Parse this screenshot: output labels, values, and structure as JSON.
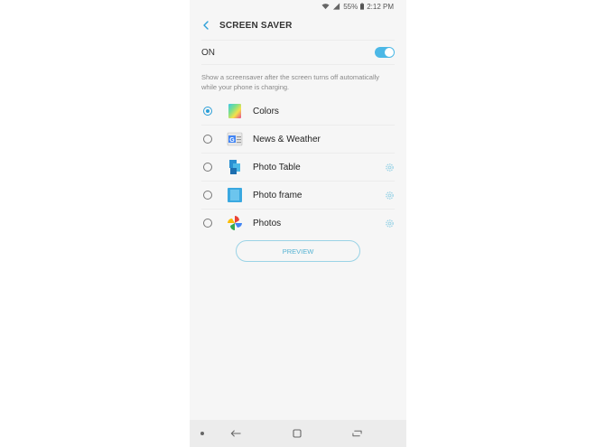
{
  "status_bar": {
    "battery": "55%",
    "time": "2:12 PM",
    "icons": [
      "wifi-icon",
      "signal-icon",
      "battery-icon"
    ]
  },
  "header": {
    "back_icon": "chevron-left-icon",
    "title": "SCREEN SAVER"
  },
  "toggle": {
    "label": "ON",
    "state": "on",
    "accent": "#4cb8e6"
  },
  "description": "Show a screensaver after the screen turns off automatically while your phone is charging.",
  "options": [
    {
      "label": "Colors",
      "icon": "colors-icon",
      "selected": true,
      "has_settings": false
    },
    {
      "label": "News & Weather",
      "icon": "news-weather-icon",
      "selected": false,
      "has_settings": false
    },
    {
      "label": "Photo Table",
      "icon": "photo-table-icon",
      "selected": false,
      "has_settings": true
    },
    {
      "label": "Photo frame",
      "icon": "photo-frame-icon",
      "selected": false,
      "has_settings": true
    },
    {
      "label": "Photos",
      "icon": "photos-icon",
      "selected": false,
      "has_settings": true
    }
  ],
  "preview_button": "PREVIEW",
  "nav_bar": [
    "dot-icon",
    "back-arrow-icon",
    "home-square-icon",
    "recents-icon"
  ],
  "colors": {
    "accent": "#2c9fd8",
    "background": "#f6f6f6"
  }
}
